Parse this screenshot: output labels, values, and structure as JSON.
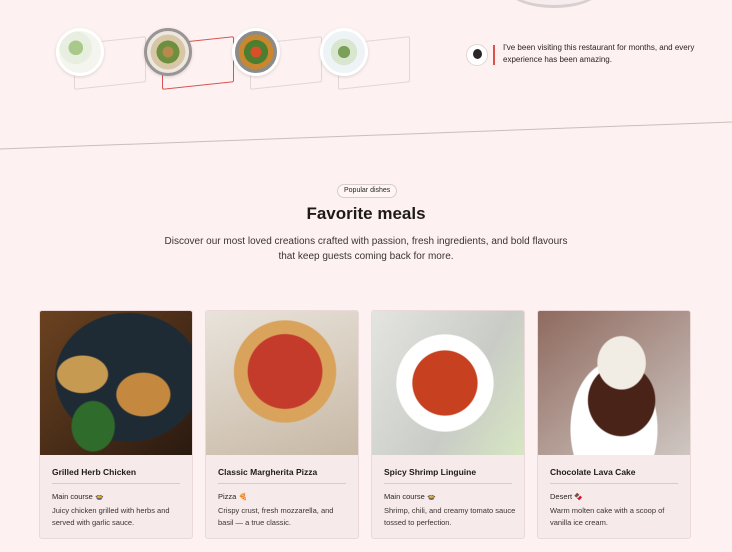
{
  "gallery": {
    "items": [
      {
        "name": "salad-plate-1",
        "active": false
      },
      {
        "name": "salad-plate-2",
        "active": true
      },
      {
        "name": "salad-plate-3",
        "active": false
      },
      {
        "name": "salad-plate-4",
        "active": false
      }
    ]
  },
  "testimonial": {
    "text": "I've been visiting this restaurant for months, and every experience has been amazing."
  },
  "section": {
    "badge": "Popular dishes",
    "title": "Favorite meals",
    "subtitle": "Discover our most loved creations crafted with passion, fresh ingredients, and bold flavours that keep guests coming back for more."
  },
  "meals": [
    {
      "name": "Grilled Herb Chicken",
      "category": "Main course",
      "category_icon": "🍲",
      "description": "Juicy chicken grilled with herbs and served with garlic sauce."
    },
    {
      "name": "Classic Margherita Pizza",
      "category": "Pizza",
      "category_icon": "🍕",
      "description": "Crispy crust, fresh mozzarella, and basil — a true classic."
    },
    {
      "name": "Spicy Shrimp Linguine",
      "category": "Main course",
      "category_icon": "🍲",
      "description": "Shrimp, chili, and creamy tomato sauce tossed to perfection."
    },
    {
      "name": "Chocolate Lava Cake",
      "category": "Desert",
      "category_icon": "🍫",
      "description": "Warm molten cake with a scoop of vanilla ice cream."
    }
  ]
}
